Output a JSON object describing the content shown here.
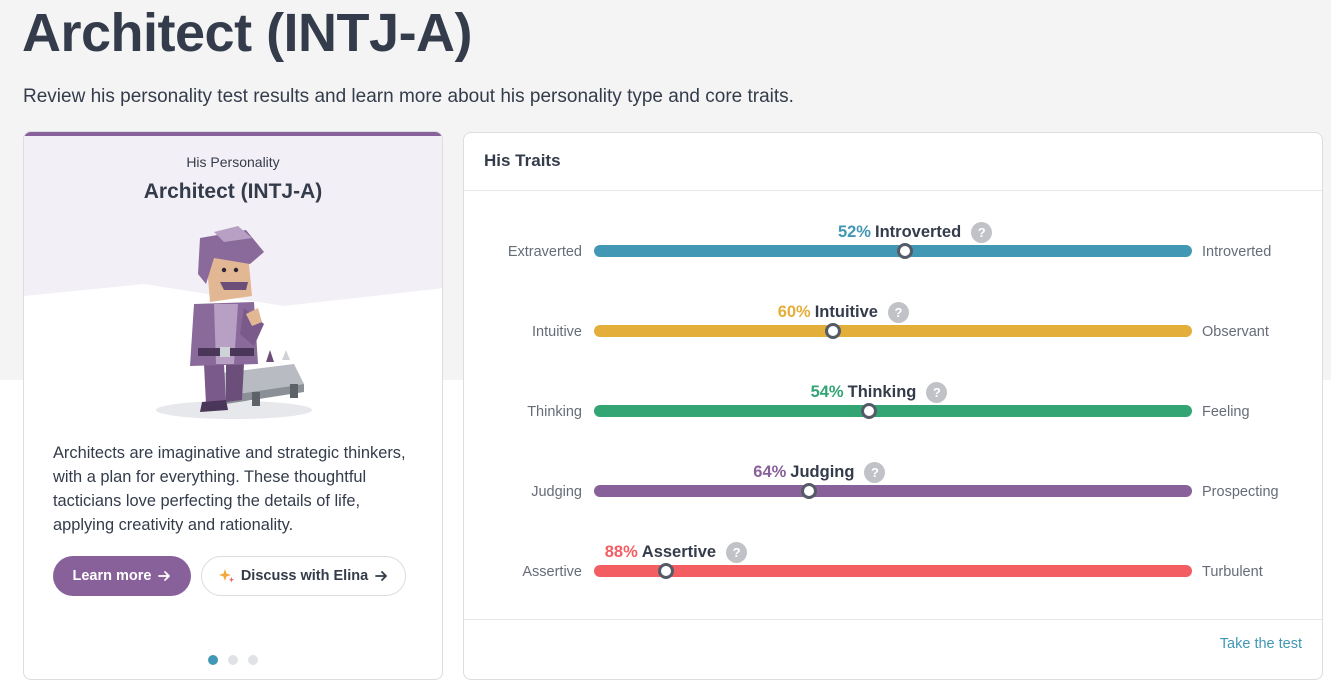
{
  "header": {
    "title": "Architect (INTJ-A)",
    "subtitle": "Review his personality test results and learn more about his personality type and core traits."
  },
  "personality_card": {
    "kicker": "His Personality",
    "type_name": "Architect (INTJ-A)",
    "description": "Architects are imaginative and strategic thinkers, with a plan for everything. These thoughtful tacticians love perfecting the details of life, applying creativity and rationality.",
    "learn_more_label": "Learn more",
    "discuss_label": "Discuss with Elina",
    "carousel": {
      "count": 3,
      "active_index": 0
    },
    "accent_color": "#88619a"
  },
  "traits_card": {
    "title": "His Traits",
    "take_test_label": "Take the test",
    "help_glyph": "?",
    "traits": [
      {
        "percent": "52%",
        "name": "Introverted",
        "left": "Extraverted",
        "right": "Introverted",
        "color": "#4298b4",
        "position": 0.52
      },
      {
        "percent": "60%",
        "name": "Intuitive",
        "left": "Intuitive",
        "right": "Observant",
        "color": "#e4ae3a",
        "position": 0.4
      },
      {
        "percent": "54%",
        "name": "Thinking",
        "left": "Thinking",
        "right": "Feeling",
        "color": "#33a474",
        "position": 0.46
      },
      {
        "percent": "64%",
        "name": "Judging",
        "left": "Judging",
        "right": "Prospecting",
        "color": "#88619a",
        "position": 0.36
      },
      {
        "percent": "88%",
        "name": "Assertive",
        "left": "Assertive",
        "right": "Turbulent",
        "color": "#f25e62",
        "position": 0.12
      }
    ]
  }
}
